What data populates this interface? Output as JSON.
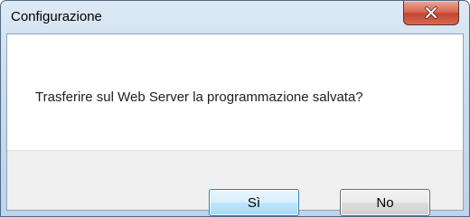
{
  "window": {
    "title": "Configurazione"
  },
  "dialog": {
    "message": "Trasferire sul Web Server la programmazione salvata?"
  },
  "buttons": {
    "yes_label": "Sì",
    "no_label": "No"
  },
  "icons": {
    "close": "close-icon"
  },
  "colors": {
    "close_button": "#c64530",
    "default_button_border": "#3c7fb1",
    "button_bar_bg": "#f0f0f0"
  }
}
